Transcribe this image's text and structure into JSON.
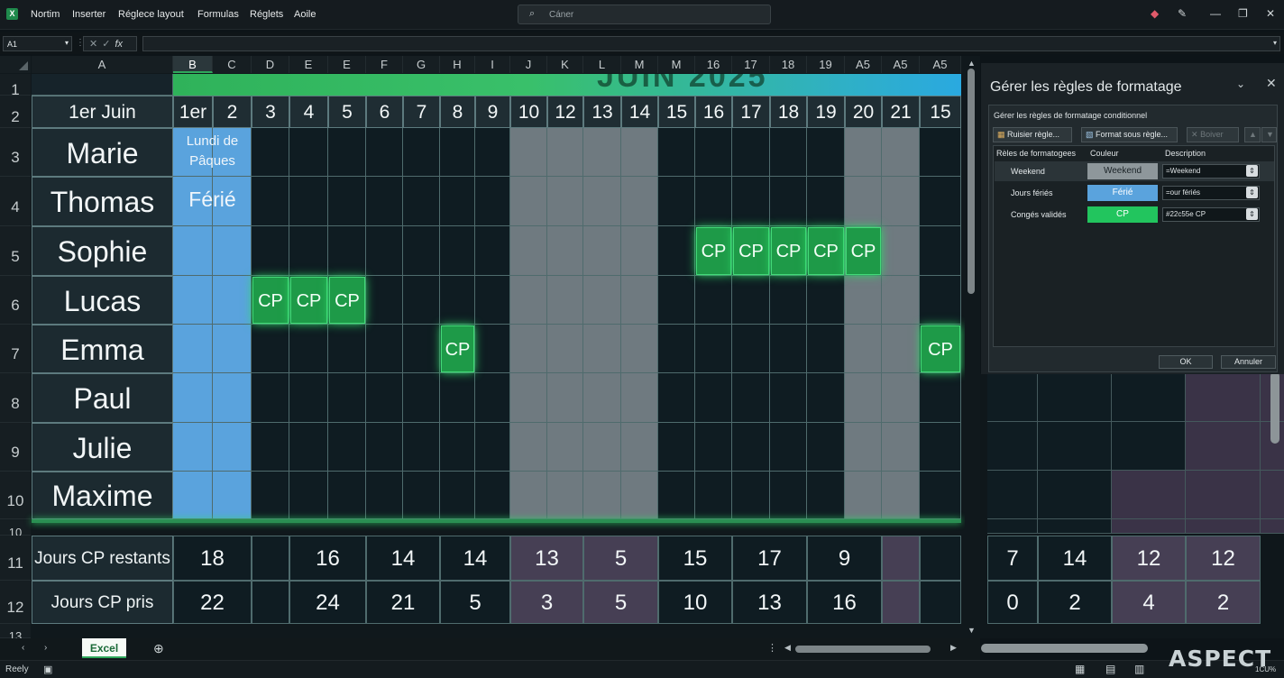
{
  "menu": [
    "Nortim",
    "Inserter",
    "Réglece layout",
    "Formulas",
    "Réglets",
    "Aoile"
  ],
  "search": {
    "placeholder": "Cáner"
  },
  "formula_bar": {
    "cell_ref": "A1",
    "fx": "fx"
  },
  "columns": [
    "A",
    "B",
    "C",
    "D",
    "E",
    "E",
    "F",
    "G",
    "H",
    "I",
    "J",
    "K",
    "L",
    "M",
    "M",
    "16",
    "17",
    "18",
    "19",
    "A5",
    "A5",
    "A5"
  ],
  "row_numbers": [
    "1",
    "2",
    "3",
    "4",
    "5",
    "6",
    "7",
    "8",
    "9",
    "10",
    "10",
    "11",
    "12",
    "13"
  ],
  "sheet": {
    "banner_title": "JUIN 2025",
    "header_label": "1er Juin",
    "day_headers": [
      "1er",
      "2",
      "3",
      "4",
      "5",
      "6",
      "7",
      "8",
      "9",
      "10",
      "12",
      "13",
      "14",
      "15",
      "16",
      "17",
      "18",
      "19",
      "20",
      "21",
      "15"
    ],
    "holiday_text_1": "Lundi de Pâques",
    "holiday_text_2": "Férié",
    "cp_label": "CP",
    "employees": [
      "Marie",
      "Thomas",
      "Sophie",
      "Lucas",
      "Emma",
      "Paul",
      "Julie",
      "Maxime"
    ],
    "summary": {
      "remaining_label": "Jours CP restants",
      "taken_label": "Jours CP pris",
      "remaining": [
        "18",
        "16",
        "14",
        "14",
        "13",
        "5",
        "15",
        "17",
        "9",
        "7",
        "14",
        "12",
        "12"
      ],
      "taken": [
        "22",
        "24",
        "21",
        "5",
        "3",
        "5",
        "10",
        "13",
        "16",
        "0",
        "2",
        "4",
        "2"
      ]
    }
  },
  "sheet_tab": "Excel",
  "status": {
    "ready": "Reely",
    "zoom": "1CU%"
  },
  "watermark": "ASPECT",
  "pane": {
    "title": "Gérer les règles de formatage",
    "subtitle": "Gérer les règles de formatage conditionnel",
    "buttons": {
      "new_rule": "Ruisier règle...",
      "format": "Format sous règle...",
      "delete": "Boiver"
    },
    "table_headers": {
      "rule": "Rèles de formatogees",
      "color": "Couleur",
      "description": "Description"
    },
    "rules": [
      {
        "name": "Weekend",
        "color_label": "Weekend",
        "color": "#8e979b",
        "description": "=Weekend"
      },
      {
        "name": "Jours fériés",
        "color_label": "Férié",
        "color": "#5aa3dd",
        "description": "=our fériés"
      },
      {
        "name": "Congés validés",
        "color_label": "CP",
        "color": "#22c55e",
        "description": "#22c55e CP"
      }
    ],
    "ok": "OK",
    "cancel": "Annuler"
  },
  "colors": {
    "cp": "#1e9a48",
    "holiday": "#5aa3dd",
    "weekend": "#6f7a80",
    "grid": "#4f6b6d"
  }
}
